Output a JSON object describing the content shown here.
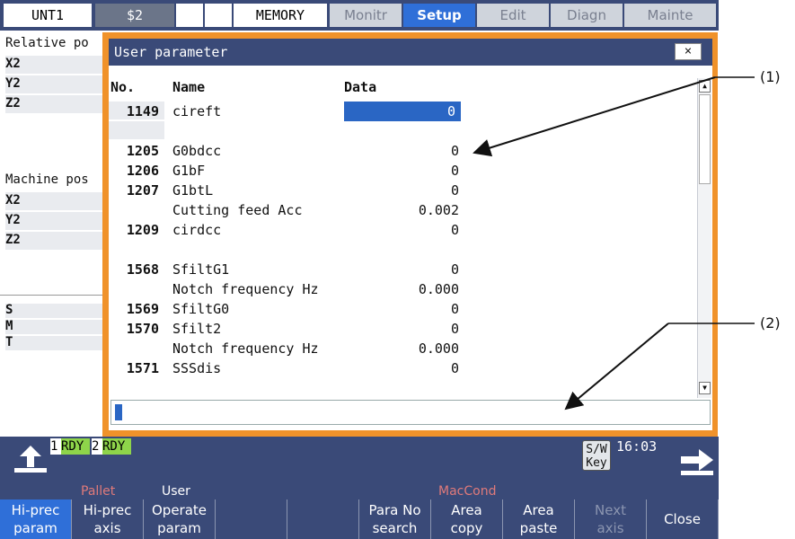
{
  "topbar": {
    "cells": [
      "UNT1",
      "$2",
      "",
      "",
      "MEMORY"
    ],
    "tabs": [
      "Monitr",
      "Setup",
      "Edit",
      "Diagn",
      "Mainte"
    ],
    "active_tab": "Setup"
  },
  "background": {
    "relative_label": "Relative po",
    "machine_label": "Machine pos",
    "axes_rel": [
      "X2",
      "Y2",
      "Z2"
    ],
    "axes_mach": [
      "X2",
      "Y2",
      "Z2"
    ],
    "smt": [
      "S",
      "M",
      "T"
    ]
  },
  "dialog": {
    "title": "User parameter",
    "close_label": "×",
    "headers": {
      "no": "No.",
      "name": "Name",
      "data": "Data"
    },
    "rows": [
      {
        "no": "1149",
        "name": "cireft",
        "data": "0",
        "selected": true
      },
      {
        "no": "",
        "name": "",
        "data": ""
      },
      {
        "no": "1205",
        "name": "G0bdcc",
        "data": "0"
      },
      {
        "no": "1206",
        "name": "G1bF",
        "data": "0"
      },
      {
        "no": "1207",
        "name": "G1btL",
        "data": "0"
      },
      {
        "no": "",
        "name": "Cutting feed Acc",
        "data": "0.002"
      },
      {
        "no": "1209",
        "name": "cirdcc",
        "data": "0"
      },
      {
        "no": "",
        "name": "",
        "data": ""
      },
      {
        "no": "1568",
        "name": "SfiltG1",
        "data": "0"
      },
      {
        "no": "",
        "name": "Notch frequency Hz",
        "data": "0.000"
      },
      {
        "no": "1569",
        "name": "SfiltG0",
        "data": "0"
      },
      {
        "no": "1570",
        "name": "Sfilt2",
        "data": "0"
      },
      {
        "no": "",
        "name": "Notch frequency Hz",
        "data": "0.000"
      },
      {
        "no": "1571",
        "name": "SSSdis",
        "data": "0"
      }
    ],
    "input_value": ""
  },
  "status": {
    "rdy1_num": "1",
    "rdy1": "RDY",
    "rdy2_num": "2",
    "rdy2": "RDY",
    "swkey_line1": "S/W",
    "swkey_line2": "Key",
    "clock": "16:03"
  },
  "menu_top": {
    "pallet": "Pallet",
    "user": "User",
    "maccond": "MacCond"
  },
  "menu": [
    {
      "line1": "Hi-prec",
      "line2": "param",
      "state": "active"
    },
    {
      "line1": "Hi-prec",
      "line2": "axis",
      "state": "normal"
    },
    {
      "line1": "Operate",
      "line2": "param",
      "state": "normal"
    },
    {
      "line1": "",
      "line2": "",
      "state": "normal"
    },
    {
      "line1": "",
      "line2": "",
      "state": "normal"
    },
    {
      "line1": "Para No",
      "line2": "search",
      "state": "normal"
    },
    {
      "line1": "Area",
      "line2": "copy",
      "state": "normal"
    },
    {
      "line1": "Area",
      "line2": "paste",
      "state": "normal"
    },
    {
      "line1": "Next",
      "line2": "axis",
      "state": "disabled"
    },
    {
      "line1": "Close",
      "line2": "",
      "state": "normal"
    }
  ],
  "callouts": [
    "(1)",
    "(2)"
  ]
}
